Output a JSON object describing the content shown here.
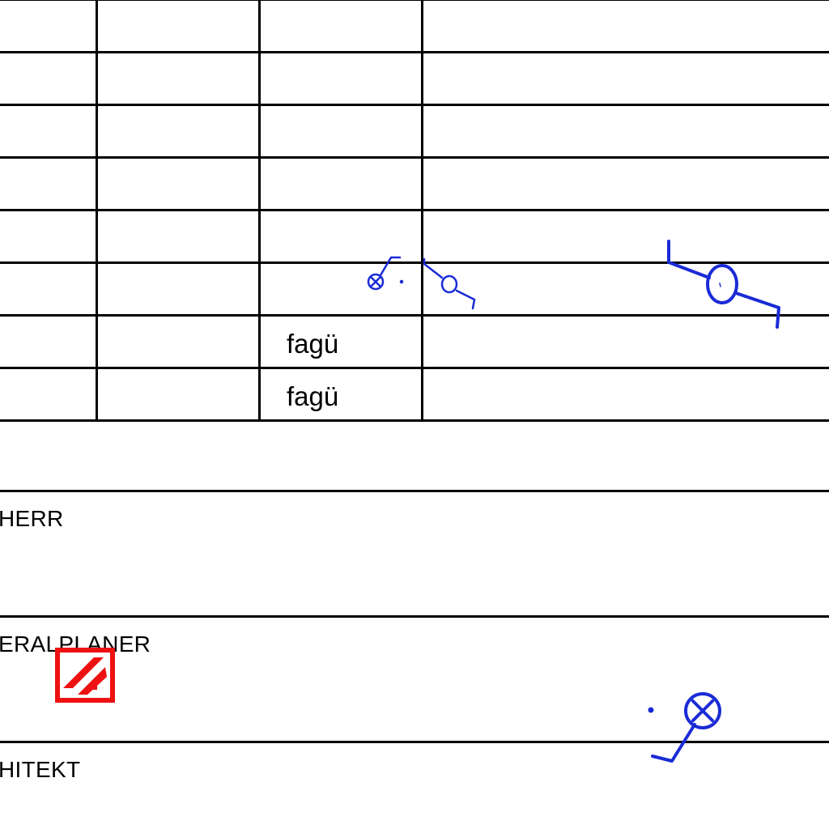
{
  "table": {
    "rows": [
      {
        "col3": ""
      },
      {
        "col3": ""
      },
      {
        "col3": ""
      },
      {
        "col3": ""
      },
      {
        "col3": ""
      },
      {
        "col3": ""
      },
      {
        "col3": "fagü"
      },
      {
        "col3": "fagü"
      }
    ]
  },
  "sections": [
    {
      "label": "HERR"
    },
    {
      "label": "ERALPLANER"
    },
    {
      "label": "HITEKT"
    }
  ],
  "colors": {
    "grid": "#000000",
    "markup": "#1a2bd6",
    "stamp": "#ee1111"
  },
  "icons": {
    "stamp": "edit-stamp-icon",
    "markup_small": "pen-markup-icon",
    "markup_large": "pen-markup-icon",
    "markup_bottom": "pen-markup-icon"
  }
}
